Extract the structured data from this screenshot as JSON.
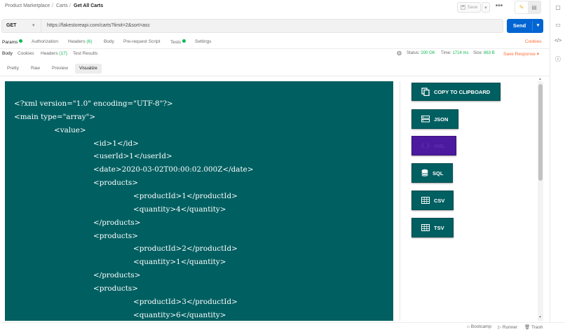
{
  "breadcrumb": {
    "parts": [
      "Product Marketplace",
      "Carts",
      "Get All Carts"
    ],
    "separator": "/"
  },
  "toolbar": {
    "save_label": "Save",
    "more_label": "•••"
  },
  "request": {
    "method": "GET",
    "url": "https://fakestoreapi.com/carts?limit=2&sort=asc",
    "send_label": "Send"
  },
  "request_tabs": {
    "params": "Params",
    "authorization": "Authorization",
    "headers": "Headers",
    "headers_count": "(6)",
    "body": "Body",
    "prerequest": "Pre-request Script",
    "tests": "Tests",
    "settings": "Settings",
    "cookies": "Cookies"
  },
  "response_tabs": {
    "body": "Body",
    "cookies": "Cookies",
    "headers": "Headers",
    "headers_count": "(17)",
    "test_results": "Test Results"
  },
  "response_status": {
    "status_label": "Status:",
    "status_value": "200 OK",
    "time_label": "Time:",
    "time_value": "1714 ms",
    "size_label": "Size:",
    "size_value": "863 B",
    "save_response": "Save Response"
  },
  "view_tabs": [
    "Pretty",
    "Raw",
    "Preview",
    "Visualize"
  ],
  "xml_lines": [
    "<?xml version=\"1.0\" encoding=\"UTF-8\"?>",
    "<main type=\"array\">",
    "<value>",
    "<id>1</id>",
    "<userId>1</userId>",
    "<date>2020-03-02T00:00:02.000Z</date>",
    "<products>",
    "<productId>1</productId>",
    "<quantity>4</quantity>",
    "</products>",
    "<products>",
    "<productId>2</productId>",
    "<quantity>1</quantity>",
    "</products>",
    "<products>",
    "<productId>3</productId>",
    "<quantity>6</quantity>"
  ],
  "visualize_buttons": {
    "copy": "COPY TO CLIPBOARD",
    "json": "JSON",
    "xml": "XML",
    "sql": "SQL",
    "csv": "CSV",
    "tsv": "TSV"
  },
  "footer": {
    "bootcamp": "Bootcamp",
    "runner": "Runner",
    "trash": "Trash"
  },
  "colors": {
    "accent": "#ff6c37",
    "send": "#0265d2",
    "teal": "#005f61",
    "purple": "#4c1a9e",
    "ok": "#0cbb52"
  }
}
